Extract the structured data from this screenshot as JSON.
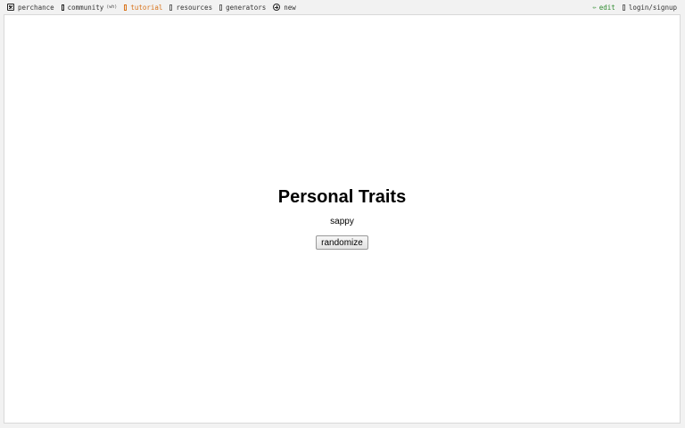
{
  "nav": {
    "left": [
      {
        "label": "perchance",
        "icon": "dice-icon"
      },
      {
        "label": "community",
        "suffix": "(wh)",
        "icon": "community-icon"
      },
      {
        "label": "tutorial",
        "icon": "tutorial-icon"
      },
      {
        "label": "resources",
        "icon": "resources-icon"
      },
      {
        "label": "generators",
        "icon": "generators-icon"
      },
      {
        "label": "new",
        "icon": "plus-circle-icon"
      }
    ],
    "right": [
      {
        "label": "edit",
        "icon": "pencil-icon"
      },
      {
        "label": "login/signup",
        "icon": "login-icon"
      }
    ]
  },
  "generator": {
    "title": "Personal Traits",
    "output": "sappy",
    "button_label": "randomize"
  },
  "colors": {
    "tutorial": "#d8731a",
    "edit": "#2d8a2d"
  }
}
